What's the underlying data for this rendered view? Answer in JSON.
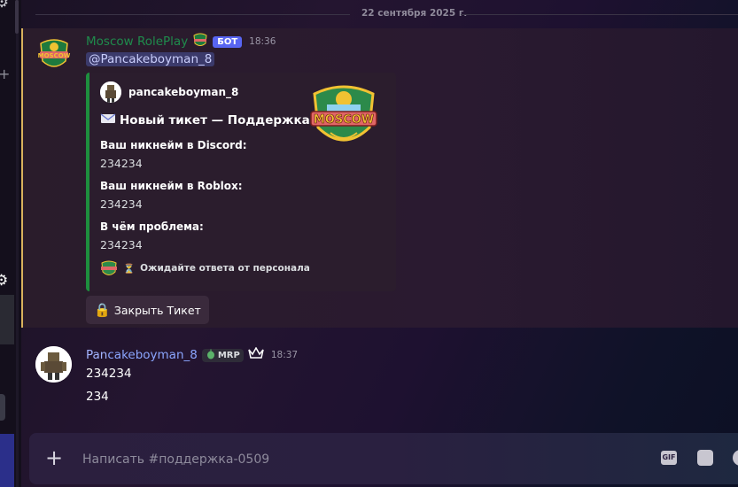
{
  "date_divider": "22 сентября 2025 г.",
  "bot_message": {
    "author": "Moscow RolePlay",
    "bot_tag": "БОТ",
    "timestamp": "18:36",
    "mention": "@Pancakeboyman_8",
    "embed": {
      "author_name": "pancakeboyman_8",
      "title": "Новый тикет — Поддержка",
      "title_icon": "envelope-icon",
      "fields": [
        {
          "name": "Ваш никнейм в Discord:",
          "value": "234234"
        },
        {
          "name": "Ваш никнейм в Roblox:",
          "value": "234234"
        },
        {
          "name": "В чём проблема:",
          "value": "234234"
        }
      ],
      "footer": "Ожидайте ответа от персонала",
      "footer_icon": "hourglass-icon",
      "thumbnail_text": "MOSCOW",
      "accent_color": "#1e8e3e"
    },
    "button_label": "Закрыть Тикет",
    "button_icon": "lock-icon"
  },
  "user_message": {
    "author_part1": "Pan",
    "author_part2": "cakeboyman_8",
    "role_badge": "MRP",
    "timestamp": "18:37",
    "lines": [
      "234234",
      "234"
    ]
  },
  "input": {
    "placeholder": "Написать #поддержка-0509",
    "gif_label": "GIF"
  },
  "colors": {
    "bot_name": "#1f8b4c",
    "bot_tag": "#5865f2",
    "highlight_bar": "#d9b25d",
    "user_name": "#8ba6ff"
  }
}
